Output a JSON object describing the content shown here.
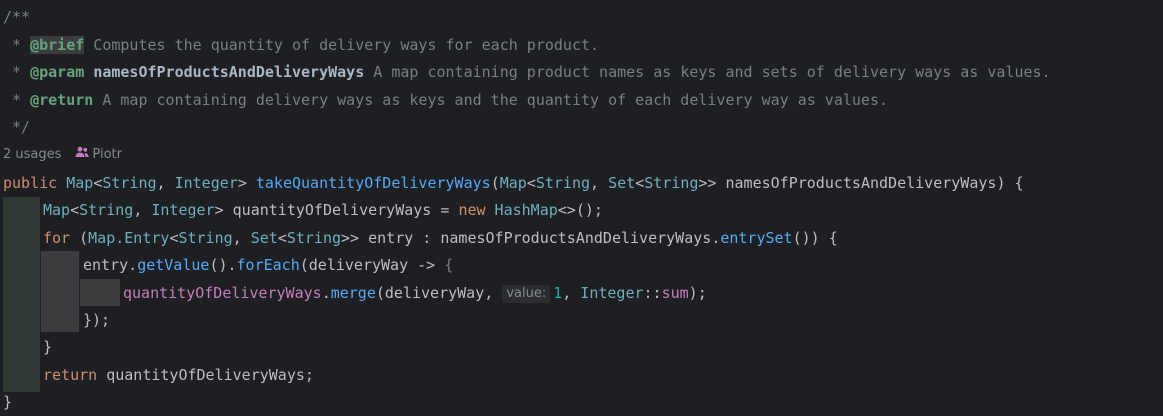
{
  "javadoc": {
    "open": "/**",
    "brief_tag": "@brief",
    "brief_text": " Computes the quantity of delivery ways for each product.",
    "param_tag": "@param",
    "param_name": "namesOfProductsAndDeliveryWays",
    "param_text": " A map containing product names as keys and sets of delivery ways as values.",
    "return_tag": "@return",
    "return_text": " A map containing delivery ways as keys and the quantity of each delivery way as values.",
    "close": " */",
    "star": " * "
  },
  "inlay": {
    "usages": "2 usages",
    "author": "Piotr",
    "param_hint": "value:"
  },
  "code": {
    "kw_public": "public",
    "map_type": "Map",
    "lt": "<",
    "string": "String",
    "comma_space": ", ",
    "integer": "Integer",
    "gt_space": "> ",
    "method_name": "takeQuantityOfDeliveryWays",
    "open_paren": "(",
    "set_type": "Set",
    "gtgt_space": ">> ",
    "param_name": "namesOfProductsAndDeliveryWays",
    "sig_end": ") {",
    "local_var": "quantityOfDeliveryWays",
    "assign": " = ",
    "kw_new": "new",
    "hashmap": " HashMap",
    "diamond": "<>();",
    "kw_for": "for",
    "for_open": " (",
    "entry_type": "Map.Entry",
    "entry_var": "entry",
    "colon": " : ",
    "entryset_call": "entrySet",
    "for_end": "()) {",
    "dot": ".",
    "getvalue": "getValue",
    "foreach": "forEach",
    "lambda_param": "(deliveryWay -> ",
    "lambda_open": "{",
    "merge": "merge",
    "merge_args_start": "(deliveryWay, ",
    "merge_num": "1",
    "merge_args_mid": ", ",
    "integer_cls": "Integer",
    "method_ref": "::",
    "sum": "sum",
    "merge_end": ");",
    "lambda_close": "});",
    "for_close": "}",
    "kw_return": "return",
    "return_var": " quantityOfDeliveryWays;",
    "method_close": "}"
  }
}
